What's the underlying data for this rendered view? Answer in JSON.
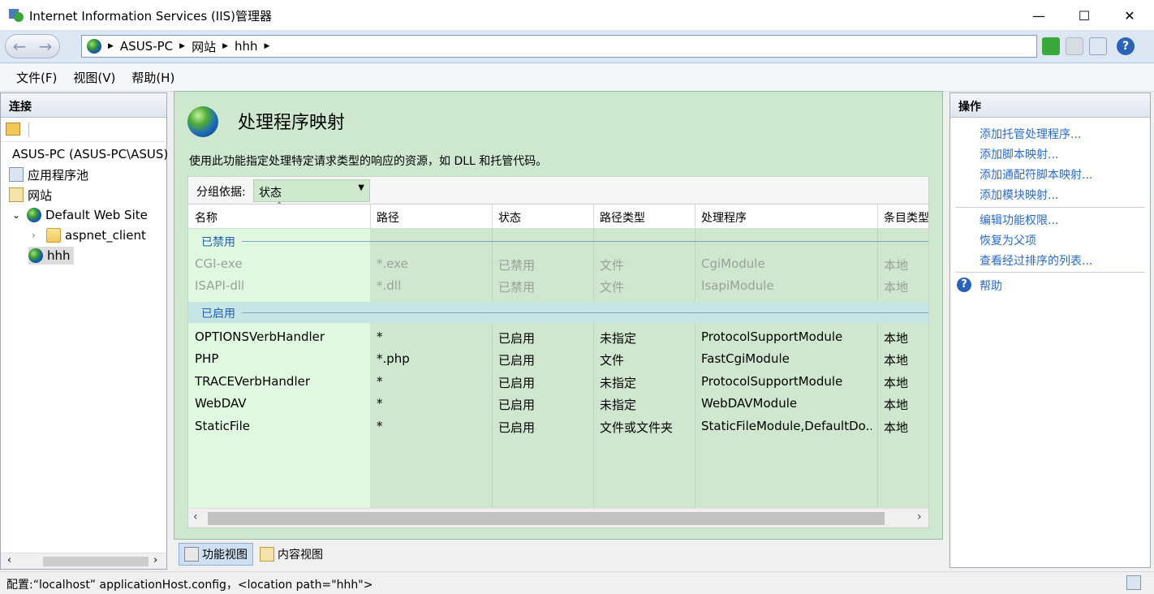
{
  "window": {
    "title": "Internet Information Services (IIS)管理器"
  },
  "address": {
    "segments": [
      "ASUS-PC",
      "网站",
      "hhh"
    ]
  },
  "menu": [
    "文件(F)",
    "视图(V)",
    "帮助(H)"
  ],
  "connections": {
    "title": "连接",
    "tree": [
      {
        "label": "ASUS-PC (ASUS-PC\\ASUS)",
        "icon": "server-icon"
      },
      {
        "label": "应用程序池",
        "icon": "app-pool-icon"
      },
      {
        "label": "网站",
        "icon": "sites-icon"
      },
      {
        "label": "Default Web Site",
        "icon": "globe-icon",
        "expanded": true
      },
      {
        "label": "aspnet_client",
        "icon": "folder-icon"
      },
      {
        "label": "hhh",
        "icon": "globe-icon",
        "selected": true
      }
    ]
  },
  "page": {
    "title": "处理程序映射",
    "description": "使用此功能指定处理特定请求类型的响应的资源，如 DLL 和托管代码。",
    "group_label": "分组依据:",
    "group_value": "状态",
    "columns": [
      "名称",
      "路径",
      "状态",
      "路径类型",
      "处理程序",
      "条目类型"
    ],
    "groups": [
      {
        "name": "已禁用",
        "rows": [
          [
            "CGI-exe",
            "*.exe",
            "已禁用",
            "文件",
            "CgiModule",
            "本地"
          ],
          [
            "ISAPI-dll",
            "*.dll",
            "已禁用",
            "文件",
            "IsapiModule",
            "本地"
          ]
        ]
      },
      {
        "name": "已启用",
        "rows": [
          [
            "OPTIONSVerbHandler",
            "*",
            "已启用",
            "未指定",
            "ProtocolSupportModule",
            "本地"
          ],
          [
            "PHP",
            "*.php",
            "已启用",
            "文件",
            "FastCgiModule",
            "本地"
          ],
          [
            "TRACEVerbHandler",
            "*",
            "已启用",
            "未指定",
            "ProtocolSupportModule",
            "本地"
          ],
          [
            "WebDAV",
            "*",
            "已启用",
            "未指定",
            "WebDAVModule",
            "本地"
          ],
          [
            "StaticFile",
            "*",
            "已启用",
            "文件或文件夹",
            "StaticFileModule,DefaultDo...",
            "本地"
          ]
        ]
      }
    ],
    "views": [
      "功能视图",
      "内容视图"
    ]
  },
  "actions": {
    "title": "操作",
    "links": [
      "添加托管处理程序...",
      "添加脚本映射...",
      "添加通配符脚本映射...",
      "添加模块映射..."
    ],
    "links2": [
      "编辑功能权限...",
      "恢复为父项",
      "查看经过排序的列表..."
    ],
    "help": "帮助"
  },
  "status": {
    "text": "配置:“localhost” applicationHost.config，<location path=\"hhh\">"
  },
  "colors": {
    "accent_link": "#2b6cc4",
    "panel_green": "#cee8d0"
  }
}
